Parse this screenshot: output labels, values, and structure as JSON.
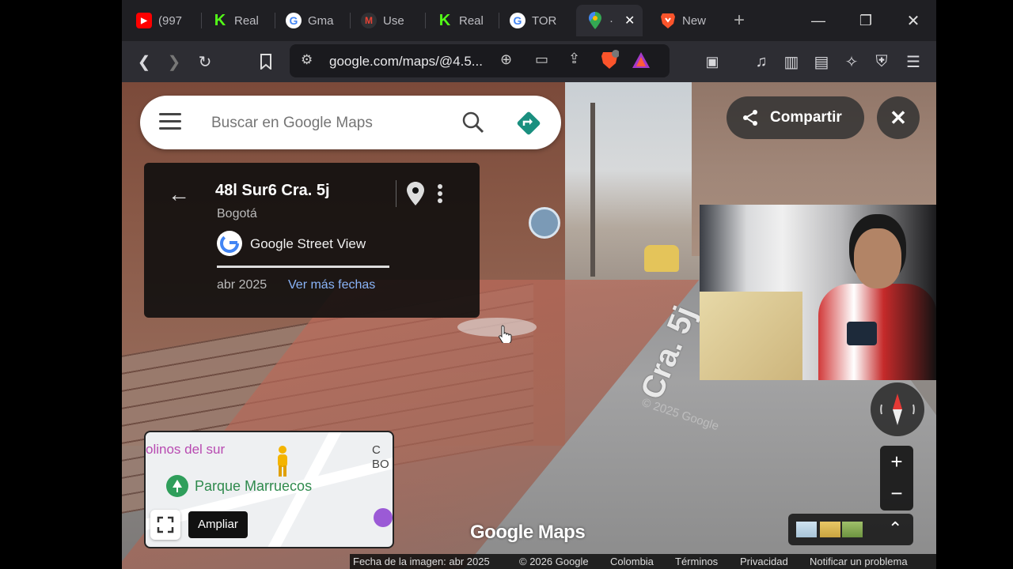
{
  "tabs": [
    {
      "label": "(997",
      "icon": "youtube-icon",
      "color": "#ff0000"
    },
    {
      "label": "Real",
      "icon": "kick-icon",
      "color": "#53fc18"
    },
    {
      "label": "Gma",
      "icon": "google-icon",
      "color": "#ffffff"
    },
    {
      "label": "Use",
      "icon": "gmail-icon",
      "color": "#ea4335"
    },
    {
      "label": "Real",
      "icon": "kick-icon",
      "color": "#53fc18"
    },
    {
      "label": "TOR",
      "icon": "google-icon",
      "color": "#ffffff"
    },
    {
      "label": "·",
      "icon": "maps-icon",
      "color": "#34a853",
      "active": true
    },
    {
      "label": "New",
      "icon": "brave-icon",
      "color": "#fb542b"
    }
  ],
  "toolbar": {
    "url": "google.com/maps/@4.5..."
  },
  "maps": {
    "search_placeholder": "Buscar en Google Maps",
    "place": {
      "address": "48l Sur6 Cra. 5j",
      "city": "Bogotá",
      "source": "Google Street View",
      "date": "abr 2025",
      "more_dates": "Ver más fechas"
    },
    "share_label": "Compartir",
    "street_label": "Cra. 5j",
    "watermark": "© 2025 Google",
    "logo": "Google Maps",
    "minimap": {
      "label_top": "olinos del sur",
      "park": "Parque Marruecos",
      "corner": "C\nBO",
      "expand_tooltip": "Ampliar"
    },
    "footer": {
      "image_date": "Fecha de la imagen: abr 2025",
      "copyright": "© 2026 Google",
      "country": "Colombia",
      "terms": "Términos",
      "privacy": "Privacidad",
      "report": "Notificar un problema"
    },
    "zoom_in": "+",
    "zoom_out": "−"
  }
}
